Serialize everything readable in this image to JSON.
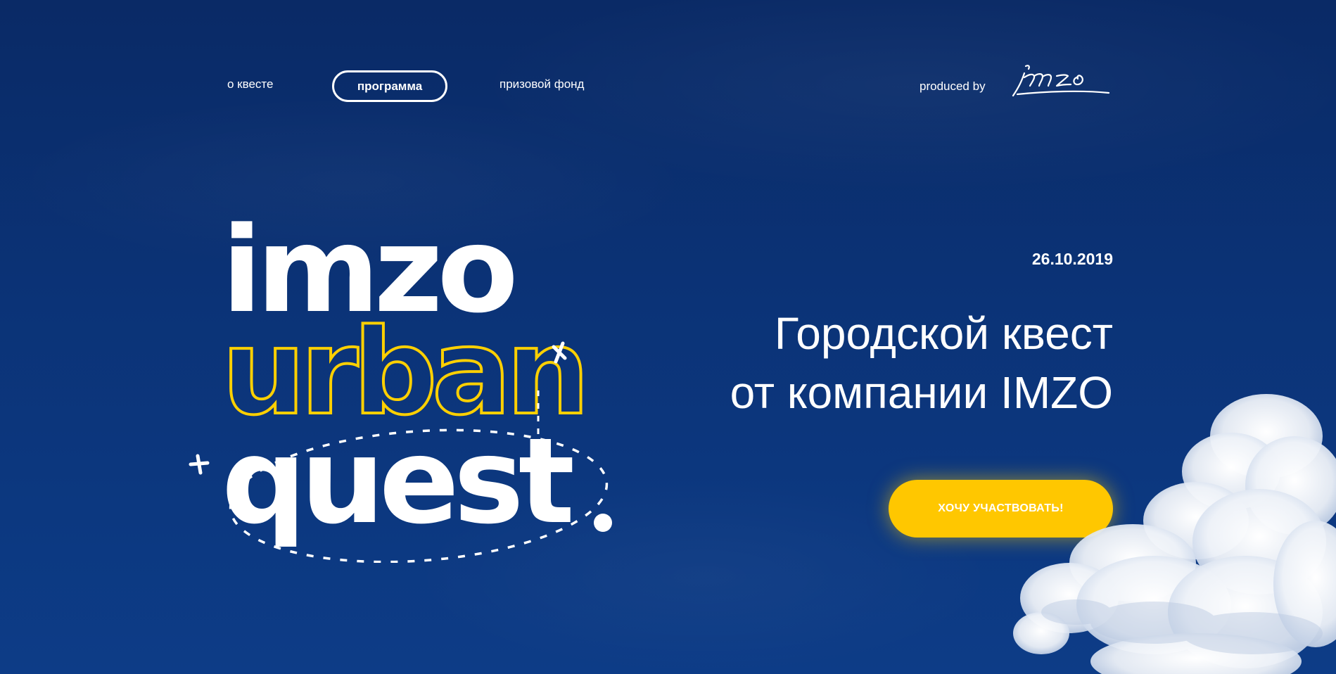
{
  "nav": {
    "items": [
      {
        "label": "о квесте",
        "active": false
      },
      {
        "label": "программа",
        "active": true
      },
      {
        "label": "призовой фонд",
        "active": false
      }
    ]
  },
  "brand": {
    "produced_by": "produced by",
    "logo_text": "imzo",
    "logo_icon": "imzo-signature-logo"
  },
  "hero": {
    "title_line1": "imzo",
    "title_line2": "urban",
    "title_line3": "quest",
    "date": "26.10.2019",
    "headline_line1": "Городской квест",
    "headline_line2": "от компании IMZO",
    "cta_label": "ХОЧУ УЧАСТВОВАТЬ!"
  },
  "colors": {
    "background": "#0b3377",
    "accent_yellow": "#ffc700",
    "outline_yellow": "#ffd000",
    "text": "#ffffff"
  }
}
